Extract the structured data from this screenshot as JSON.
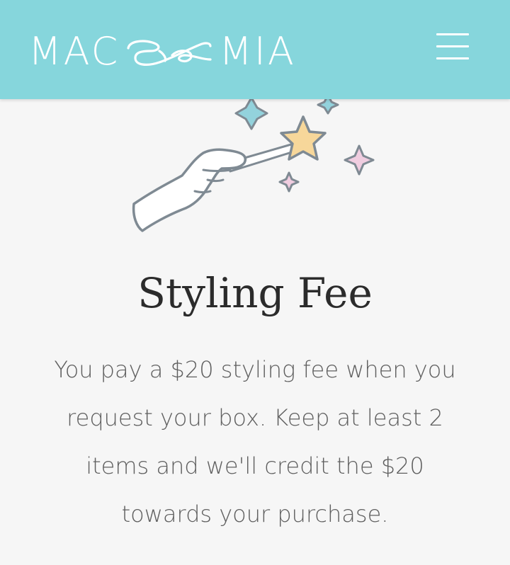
{
  "header": {
    "logo_left": "MAC",
    "logo_right": "MIA",
    "menu_icon": "hamburger-menu-icon",
    "background_color": "#86d6dc"
  },
  "hero": {
    "illustration": "hand-with-magic-wand-illustration",
    "star_color": "#f7d79a",
    "sparkle_colors": [
      "#93d2dc",
      "#f0cde0"
    ]
  },
  "content": {
    "title": "Styling Fee",
    "description": "You pay a $20 styling fee when you request your box. Keep at least 2 items and we'll credit the $20 towards your purchase."
  }
}
